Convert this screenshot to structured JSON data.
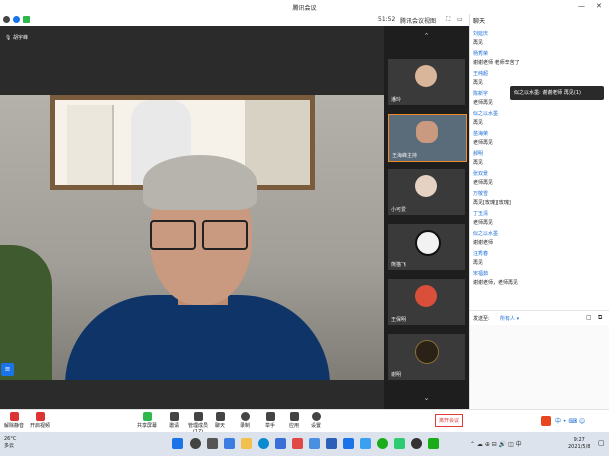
{
  "window": {
    "title": "腾讯会议"
  },
  "toolbar": {
    "time": "51:52",
    "label": "腾讯会议视图",
    "chat_label": "聊天"
  },
  "video": {
    "speaker_tag": "胡宇峰"
  },
  "participants": [
    {
      "name": "潘玲"
    },
    {
      "name": "王海峰主持"
    },
    {
      "name": "小可爱"
    },
    {
      "name": "熊猫飞"
    },
    {
      "name": "王保明"
    },
    {
      "name": "谢明"
    }
  ],
  "chat": {
    "messages": [
      {
        "name": "刘延庆",
        "text": "再见"
      },
      {
        "name": "杨秀荣",
        "text": "谢谢老师 老师辛苦了"
      },
      {
        "name": "王纯超",
        "text": "再见"
      },
      {
        "name": "陈新宇",
        "text": "老师再见"
      },
      {
        "name": "似之以水墨",
        "text": "再见"
      },
      {
        "name": "苗海荣",
        "text": "老师再见"
      },
      {
        "name": "郝明",
        "text": "再见"
      },
      {
        "name": "张双景",
        "text": "老师再见"
      },
      {
        "name": "万敬雪",
        "text": "再见[玫瑰][玫瑰]"
      },
      {
        "name": "丁玉清",
        "text": "老师再见"
      },
      {
        "name": "似之以水墨",
        "text": "谢谢老师"
      },
      {
        "name": "汪秀春",
        "text": "再见"
      },
      {
        "name": "宋福茹",
        "text": "谢谢老师，老师再见"
      }
    ],
    "send_label": "发送至:",
    "send_target": "所有人 ▾",
    "notification": "似之以水墨: 谢谢老师 再见(1)"
  },
  "bottombar": {
    "items": [
      {
        "label": "解除静音"
      },
      {
        "label": "开启视频"
      },
      {
        "label": "共享屏幕"
      },
      {
        "label": "邀请"
      },
      {
        "label": "管理成员(17)"
      },
      {
        "label": "聊天"
      },
      {
        "label": "录制"
      },
      {
        "label": "举手"
      },
      {
        "label": "应用"
      },
      {
        "label": "设置"
      }
    ],
    "leave": "离开会议"
  },
  "taskbar": {
    "weather_temp": "26°C",
    "weather_desc": "多云",
    "time": "9:27",
    "date": "2021/5/8"
  },
  "colors": {
    "accent": "#1a73e8",
    "leave": "#e03b3b",
    "speaker": "#f08a24"
  }
}
